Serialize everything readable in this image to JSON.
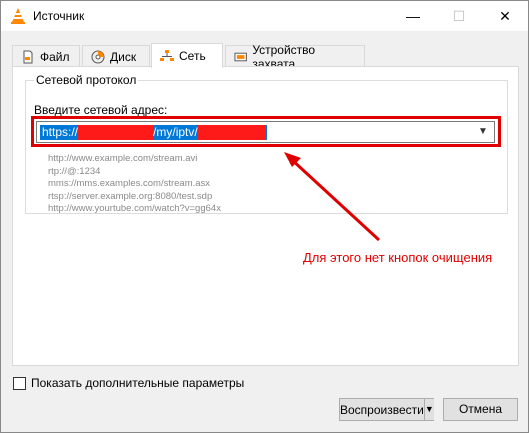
{
  "window": {
    "title": "Источник",
    "controls": {
      "minimize": "—",
      "maximize": "☐",
      "close": "✕"
    }
  },
  "tabs": [
    {
      "label": "Файл",
      "icon": "file-icon",
      "active": false
    },
    {
      "label": "Диск",
      "icon": "disc-icon",
      "active": false
    },
    {
      "label": "Сеть",
      "icon": "network-icon",
      "active": true
    },
    {
      "label": "Устройство захвата",
      "icon": "capture-device-icon",
      "active": false
    }
  ],
  "network": {
    "group_title": "Сетевой протокол",
    "address_label": "Введите сетевой адрес:",
    "address_value_parts": [
      "https://",
      "/my/iptv/"
    ],
    "examples": [
      "http://www.example.com/stream.avi",
      "rtp://@:1234",
      "mms://mms.examples.com/stream.asx",
      "rtsp://server.example.org:8080/test.sdp",
      "http://www.yourtube.com/watch?v=gg64x"
    ]
  },
  "annotation": {
    "text": "Для этого нет кнопок очищения",
    "color": "#e00000"
  },
  "options": {
    "show_more_label": "Показать дополнительные параметры",
    "checked": false
  },
  "buttons": {
    "play_label": "Воспроизвести",
    "cancel_label": "Отмена"
  },
  "colors": {
    "highlight": "#e00000",
    "selection": "#0078d7",
    "redaction": "#ff1a1a"
  }
}
